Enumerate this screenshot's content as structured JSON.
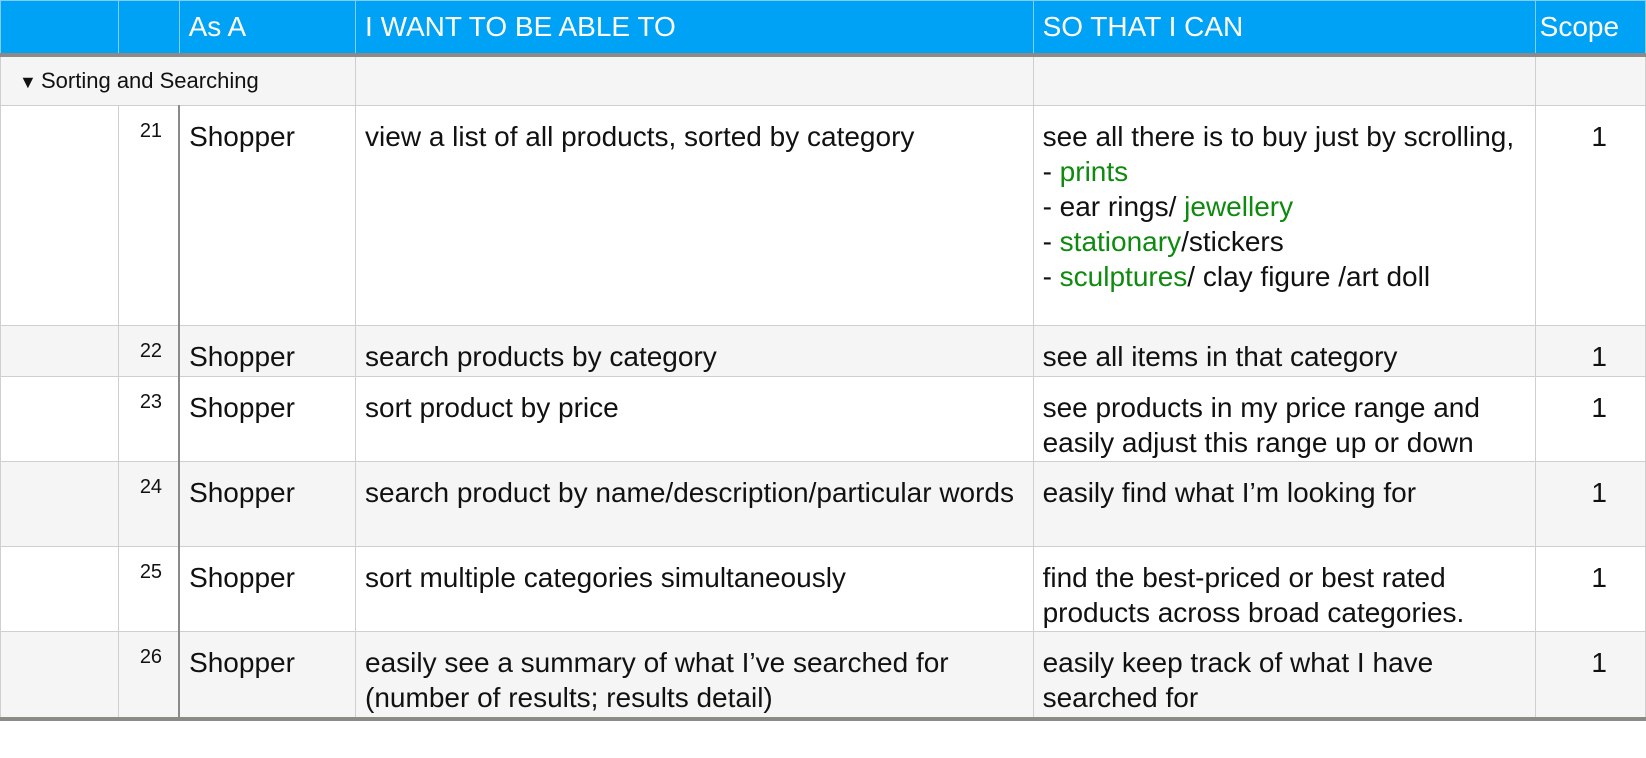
{
  "columns": {
    "col_a": "",
    "col_b": "",
    "as_a": "As A",
    "want": "I WANT TO BE ABLE TO",
    "so_that": "SO THAT I CAN",
    "scope": "Scope"
  },
  "category": {
    "toggle_icon": "triangle-down-icon",
    "label": "Sorting and Searching"
  },
  "colors": {
    "header_bg": "#00a2f5",
    "header_text": "#ffffff",
    "highlight_text": "#0e8a0e",
    "alt_row_bg": "#f5f5f5"
  },
  "rows": [
    {
      "id": "21",
      "as_a": "Shopper",
      "want": "view a list of all products, sorted by category",
      "so_intro": "see all there is to buy just by scrolling,",
      "so_items": [
        {
          "prefix": "- ",
          "green": "prints",
          "rest": ""
        },
        {
          "prefix": "- ear rings/ ",
          "green": "jewellery",
          "rest": ""
        },
        {
          "prefix": "- ",
          "green": "stationary",
          "rest": "/stickers"
        },
        {
          "prefix": "- ",
          "green": "sculptures",
          "rest": "/ clay figure /art doll"
        }
      ],
      "scope": "1"
    },
    {
      "id": "22",
      "as_a": "Shopper",
      "want": "search products by category",
      "so_that": "see all items in that category",
      "scope": "1"
    },
    {
      "id": "23",
      "as_a": "Shopper",
      "want": "sort product by price",
      "so_that": "see products in my price range and easily adjust this range up or down",
      "scope": "1"
    },
    {
      "id": "24",
      "as_a": "Shopper",
      "want": "search product by name/description/particular words",
      "so_that": "easily find what I’m looking for",
      "scope": "1"
    },
    {
      "id": "25",
      "as_a": "Shopper",
      "want": "sort multiple categories simultaneously",
      "so_that": "find the best-priced or best rated products across broad categories.",
      "scope": "1"
    },
    {
      "id": "26",
      "as_a": "Shopper",
      "want": "easily see a summary of what I’ve searched for (number of results; results detail)",
      "so_that": "easily keep track of what I have searched for",
      "scope": "1"
    }
  ]
}
